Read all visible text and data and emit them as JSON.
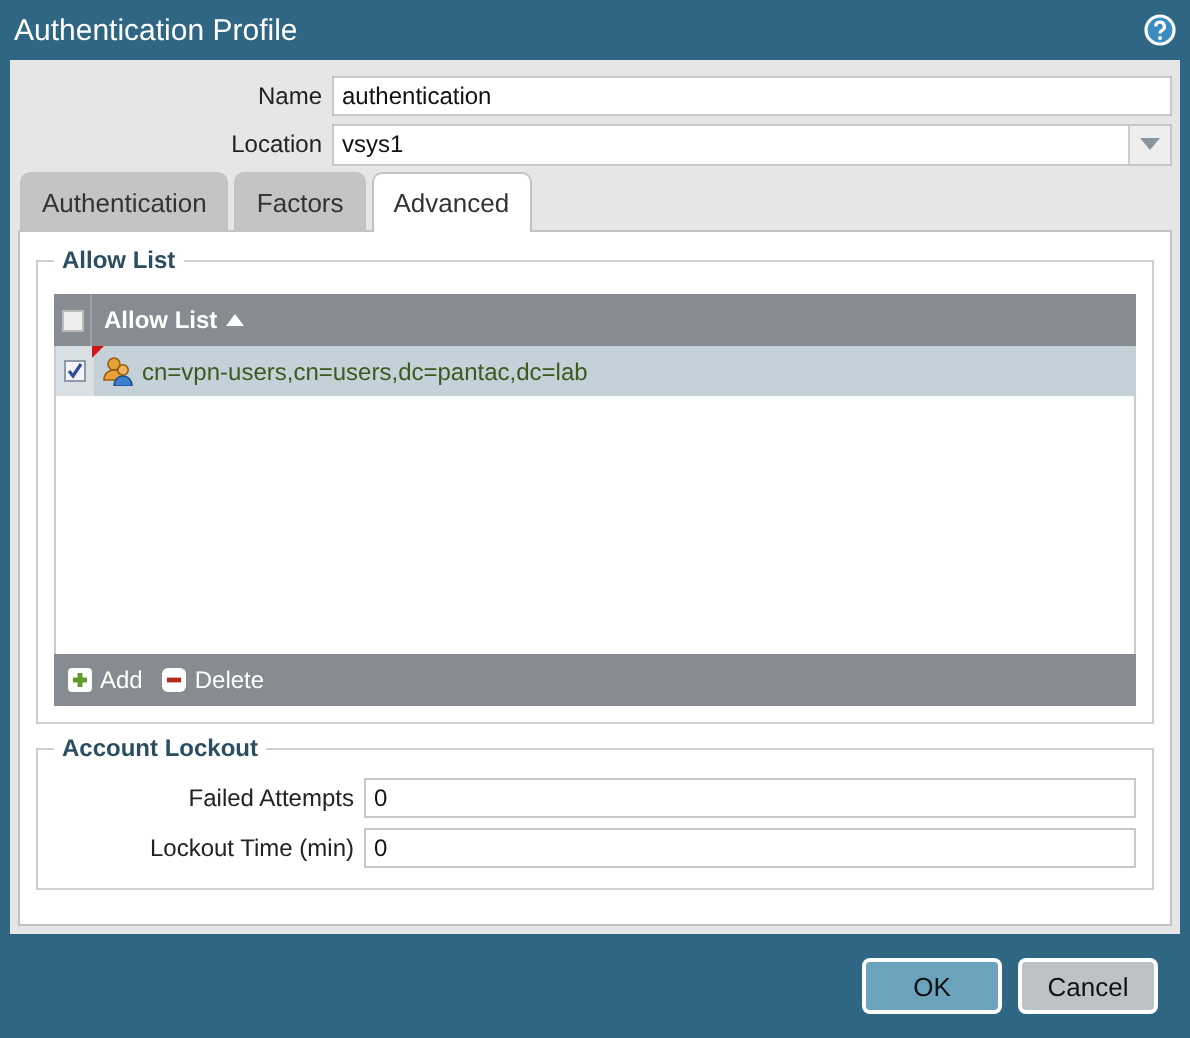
{
  "window": {
    "title": "Authentication Profile"
  },
  "fields": [
    {
      "label": "Name",
      "value": "authentication",
      "kind": "text"
    },
    {
      "label": "Location",
      "value": "vsys1",
      "kind": "dropdown"
    }
  ],
  "tabs": [
    {
      "label": "Authentication",
      "selected": false
    },
    {
      "label": "Factors",
      "selected": false
    },
    {
      "label": "Advanced",
      "selected": true
    }
  ],
  "allow_list": {
    "legend": "Allow List",
    "column": "Allow List",
    "select_all_checked": false,
    "rows": [
      {
        "text": "cn=vpn-users,cn=users,dc=pantac,dc=lab",
        "checked": true,
        "selected": true,
        "flagged": true
      }
    ],
    "actions": [
      {
        "label": "Add",
        "kind": "add"
      },
      {
        "label": "Delete",
        "kind": "delete"
      }
    ]
  },
  "account_lockout": {
    "legend": "Account Lockout",
    "fields": [
      {
        "label": "Failed Attempts",
        "value": "0"
      },
      {
        "label": "Lockout Time (min)",
        "value": "0"
      }
    ]
  },
  "buttons": [
    {
      "label": "OK",
      "kind": "primary"
    },
    {
      "label": "Cancel",
      "kind": "secondary"
    }
  ]
}
